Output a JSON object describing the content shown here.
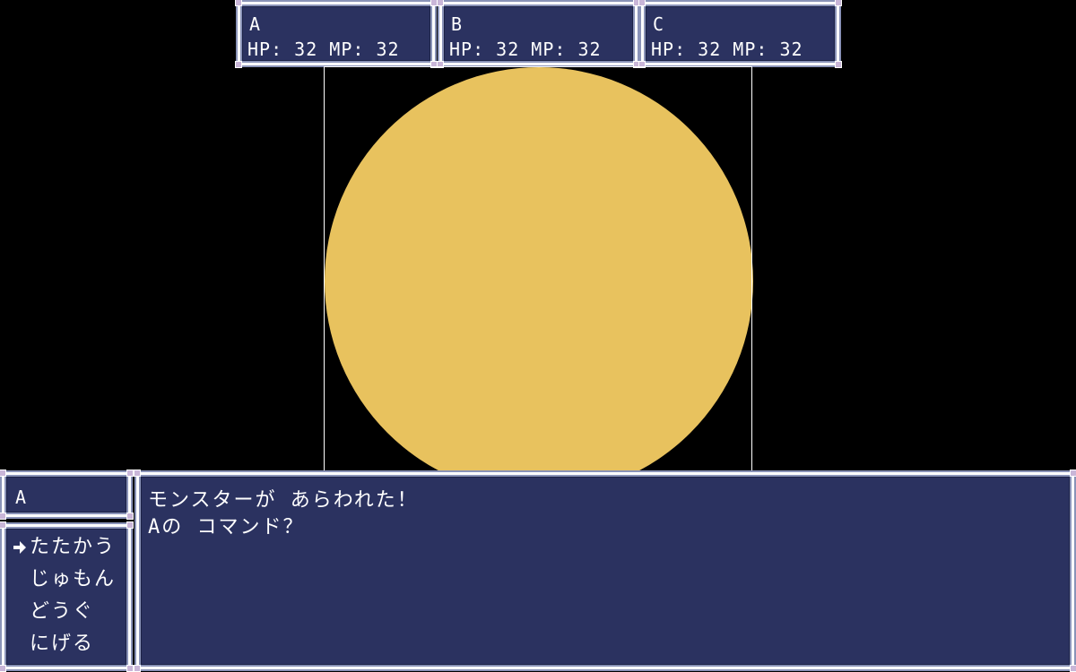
{
  "colors": {
    "background": "#000000",
    "window_fill": "#2b3260",
    "window_border": "#ffffff",
    "monster_fill": "#e8c25e",
    "text": "#ffffff"
  },
  "party": [
    {
      "name": "A",
      "status": "HP: 32 MP: 32"
    },
    {
      "name": "B",
      "status": "HP: 32 MP: 32"
    },
    {
      "name": "C",
      "status": "HP: 32 MP: 32"
    }
  ],
  "monster": {
    "shape_icon": "circle-monster-icon"
  },
  "actor": {
    "name": "A"
  },
  "commands": {
    "cursor_icon": "arrow-right-icon",
    "selected_index": 0,
    "items": [
      {
        "label": "たたかう"
      },
      {
        "label": "じゅもん"
      },
      {
        "label": "どうぐ"
      },
      {
        "label": "にげる"
      }
    ]
  },
  "message": {
    "line1": "モンスターが あらわれた！",
    "line2": "Aの コマンド？"
  }
}
